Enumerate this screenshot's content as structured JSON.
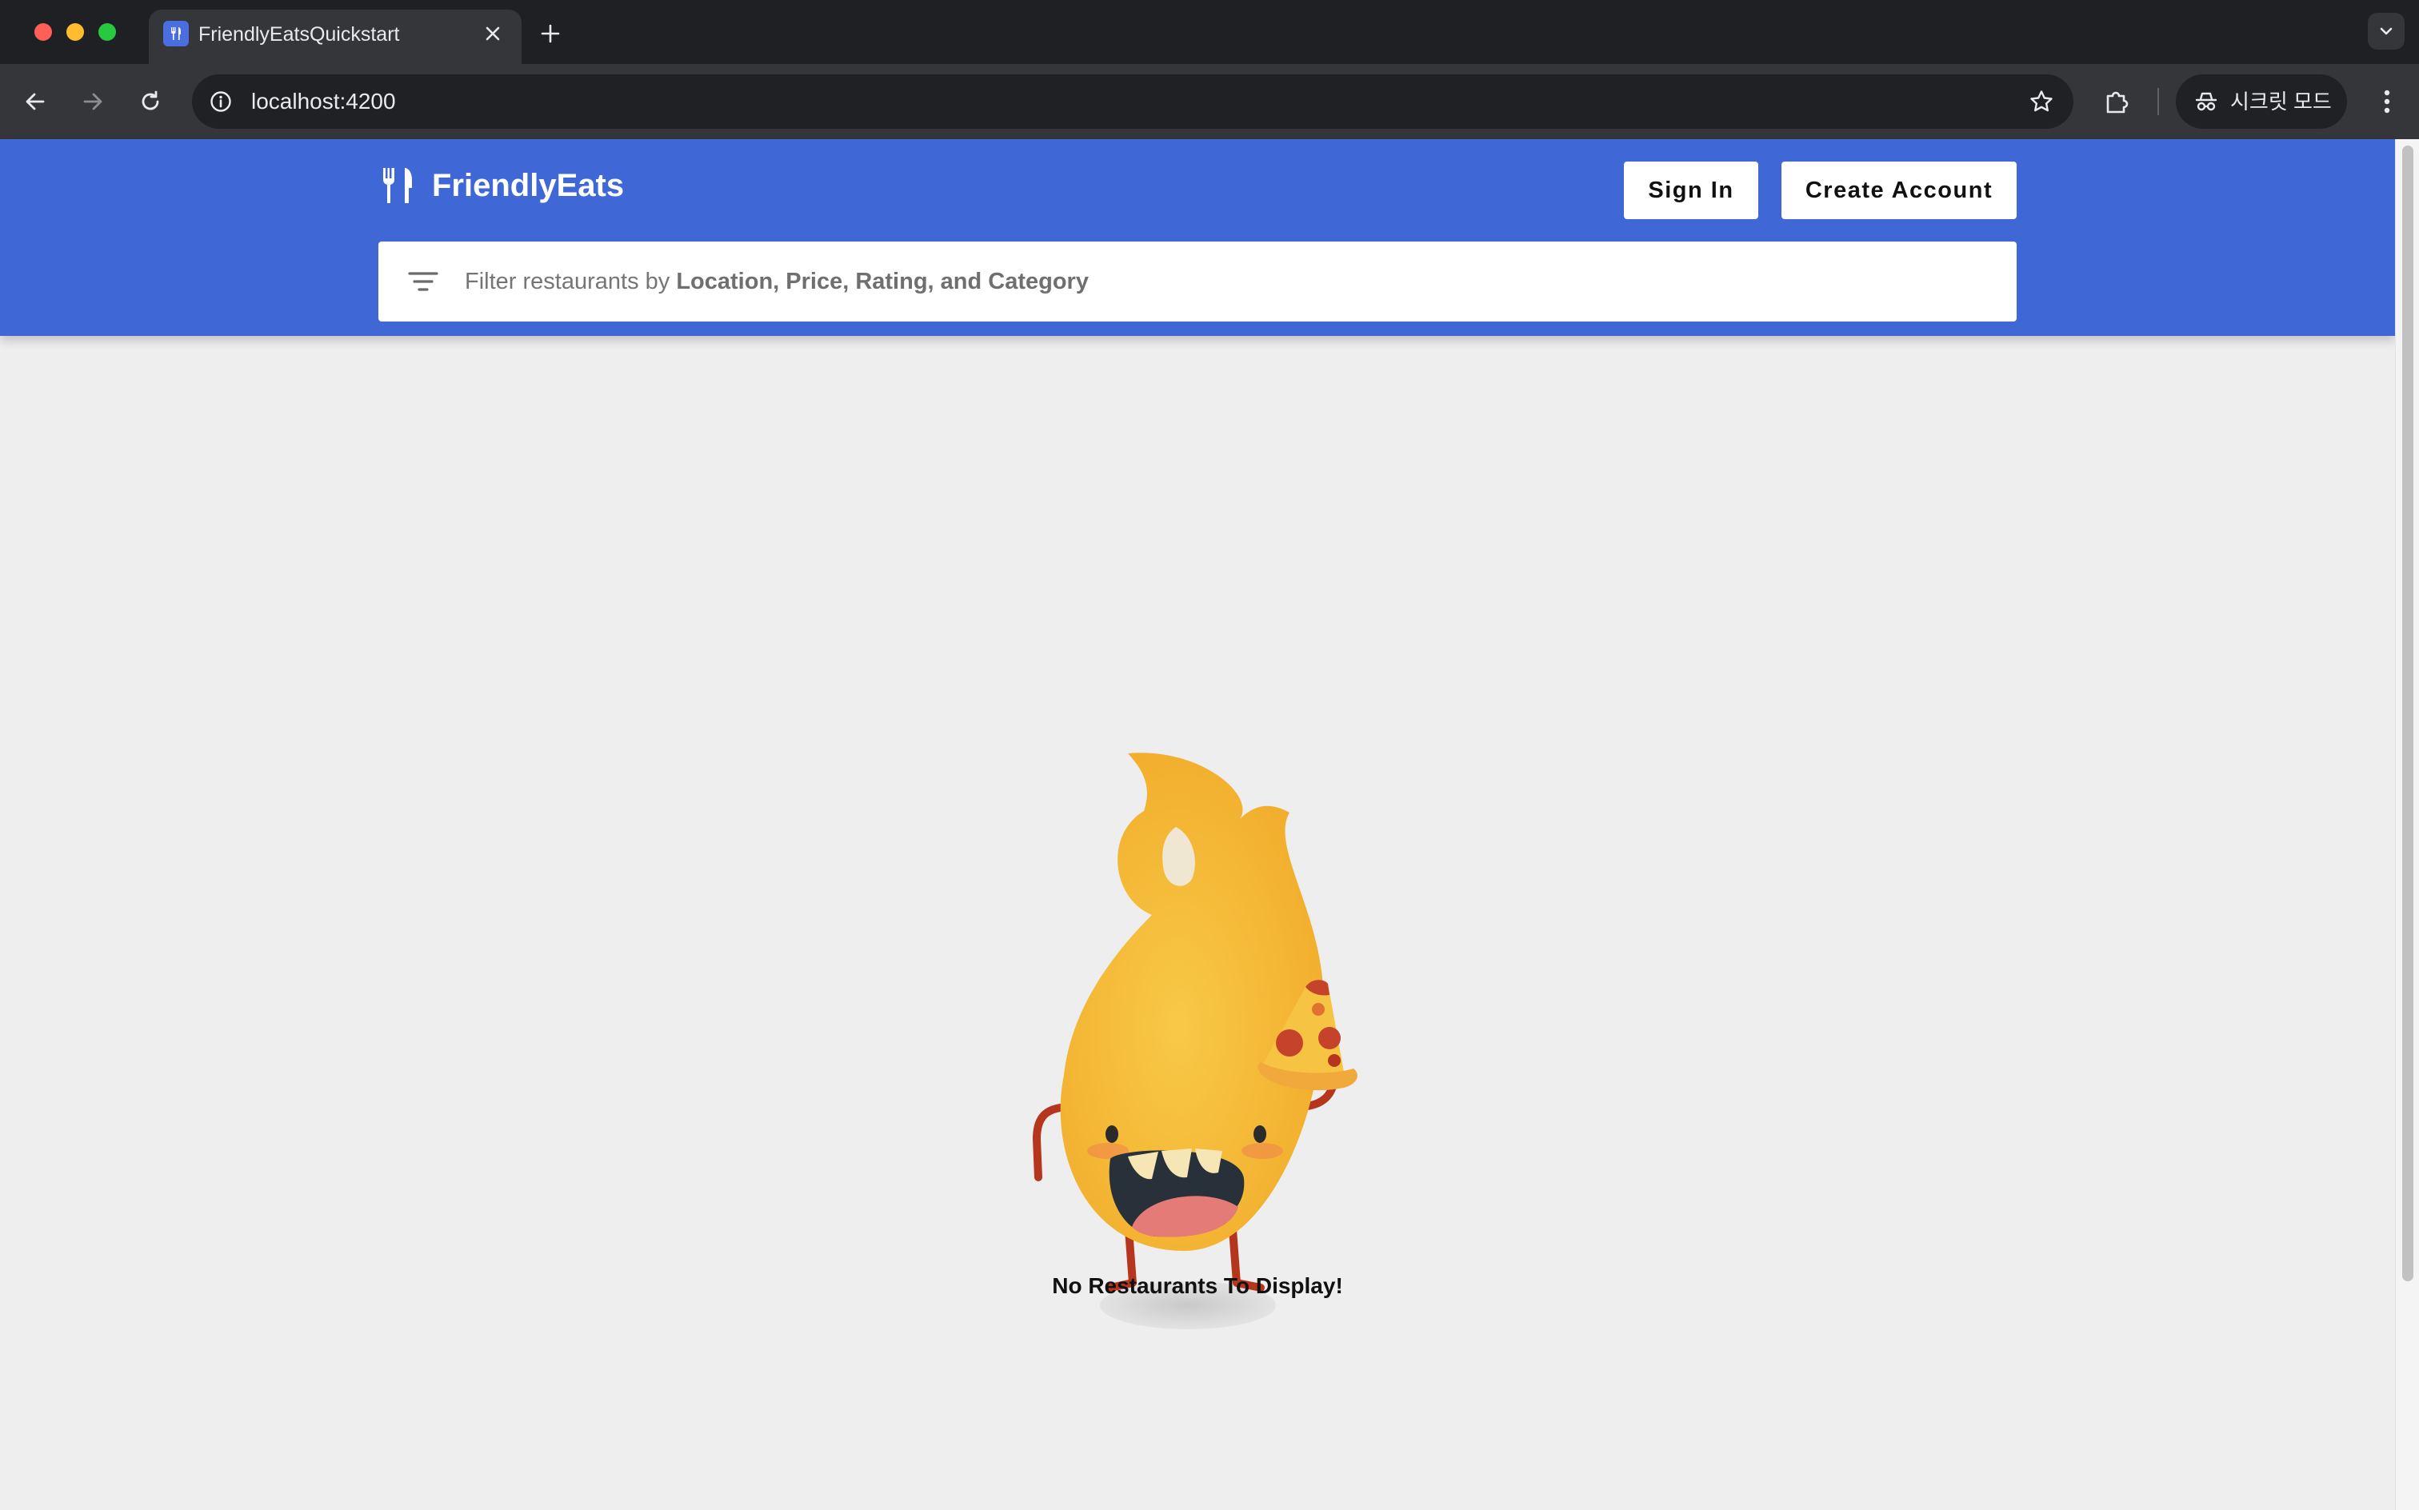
{
  "browser": {
    "tab_title": "FriendlyEatsQuickstart",
    "url": "localhost:4200",
    "profile_label": "시크릿 모드"
  },
  "header": {
    "brand_name": "FriendlyEats",
    "sign_in_label": "Sign In",
    "create_account_label": "Create Account"
  },
  "filter": {
    "prefix": "Filter restaurants by ",
    "emphasis": "Location, Price, Rating, and Category"
  },
  "main": {
    "empty_message": "No Restaurants To Display!"
  },
  "colors": {
    "header_blue": "#3f67d5",
    "page_background": "#eeeeee",
    "mascot_yellow": "#f6c343"
  },
  "icons": {
    "brand": "fork-knife-icon",
    "filter": "filter-list-icon"
  }
}
